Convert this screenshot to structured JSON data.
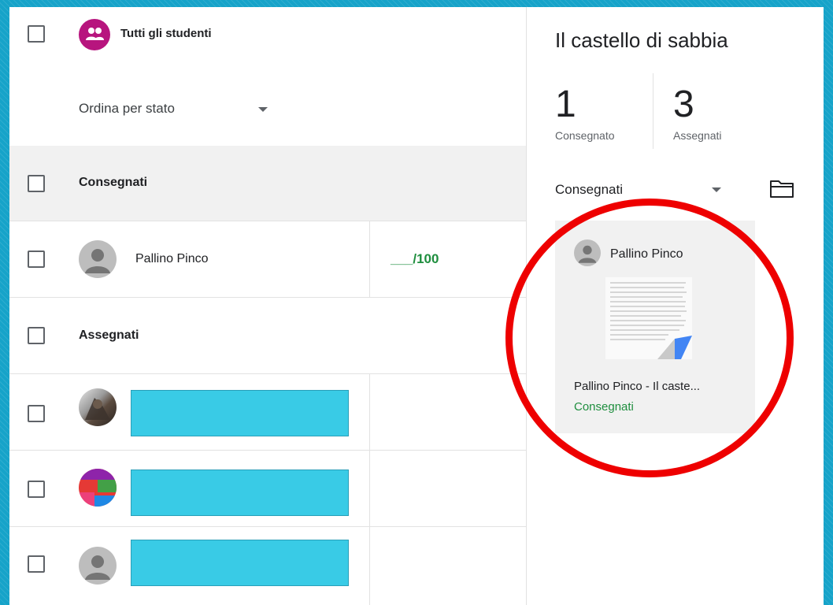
{
  "header": {
    "all_students_label": "Tutti gli studenti",
    "sort_label": "Ordina per stato"
  },
  "sections": {
    "turned_in_label": "Consegnati",
    "assigned_label": "Assegnati"
  },
  "students": {
    "turned_in": [
      {
        "name": "Pallino Pinco",
        "grade": "___/100"
      }
    ]
  },
  "assignment": {
    "title": "Il castello di sabbia",
    "turned_in_count": "1",
    "turned_in_count_label": "Consegnato",
    "assigned_count": "3",
    "assigned_count_label": "Assegnati",
    "filter_value": "Consegnati"
  },
  "submission_card": {
    "student_name": "Pallino Pinco",
    "file_name": "Pallino Pinco - Il caste...",
    "status": "Consegnati"
  },
  "colors": {
    "background": "#16a3c9",
    "group_avatar": "#b7157e",
    "grade_green": "#1e8e3e",
    "redaction": "#39cbe6",
    "highlight_ring": "#ee0000",
    "docs_blue": "#4285f4"
  },
  "icons": {
    "group": "people-icon",
    "dropdown": "dropdown-arrow-icon",
    "folder": "folder-icon",
    "person": "person-icon",
    "document": "document-icon"
  }
}
